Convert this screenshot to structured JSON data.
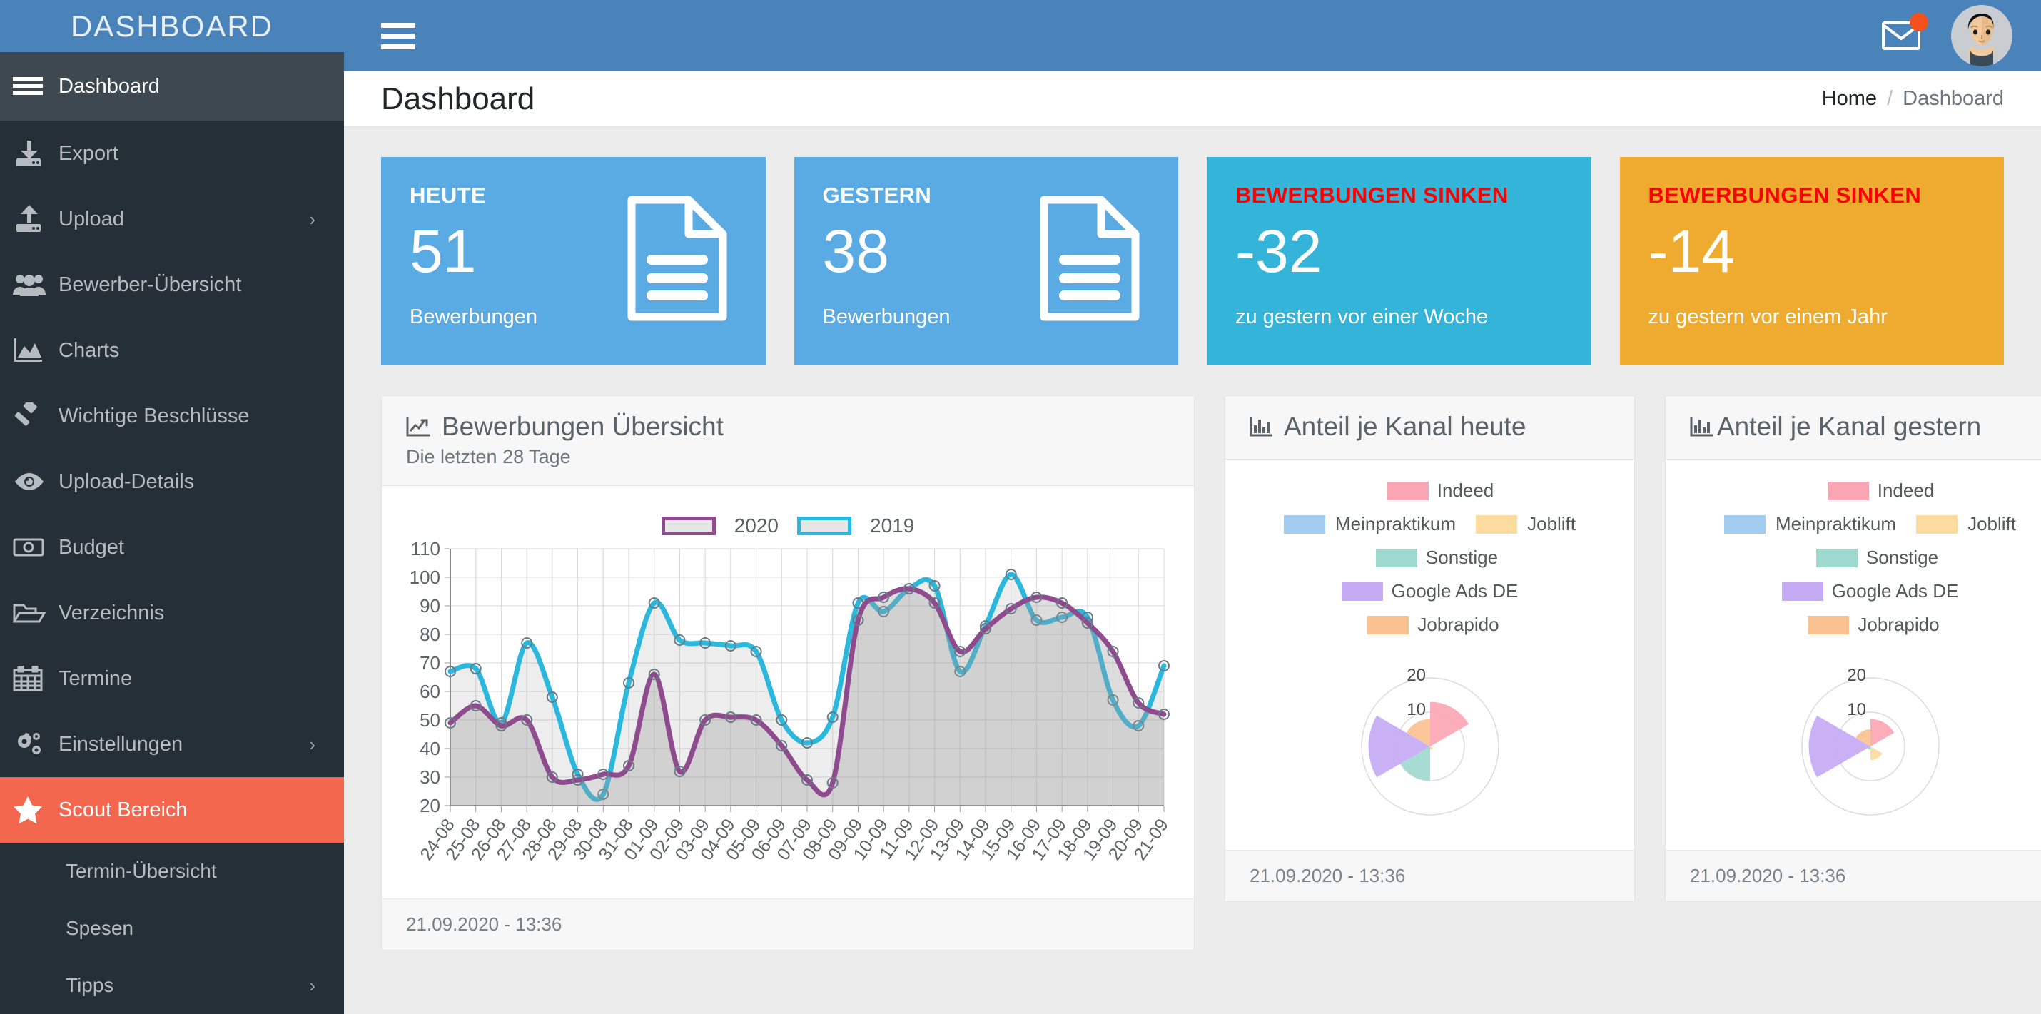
{
  "brand": {
    "title": "DASHBOARD"
  },
  "topbar": {
    "burger_icon": "hamburger-icon",
    "mail_icon": "envelope-icon",
    "avatar_icon": "user-avatar"
  },
  "pagehead": {
    "title": "Dashboard",
    "breadcrumb": {
      "home": "Home",
      "sep": "/",
      "current": "Dashboard"
    }
  },
  "sidebar": {
    "items": [
      {
        "label": "Dashboard",
        "icon": "hamburger-icon",
        "state": "active",
        "chevron": ""
      },
      {
        "label": "Export",
        "icon": "download-icon",
        "chevron": ""
      },
      {
        "label": "Upload",
        "icon": "upload-icon",
        "chevron": "›"
      },
      {
        "label": "Bewerber-Übersicht",
        "icon": "users-icon",
        "chevron": ""
      },
      {
        "label": "Charts",
        "icon": "area-chart-icon",
        "chevron": ""
      },
      {
        "label": "Wichtige Beschlüsse",
        "icon": "gavel-icon",
        "chevron": ""
      },
      {
        "label": "Upload-Details",
        "icon": "eye-icon",
        "chevron": ""
      },
      {
        "label": "Budget",
        "icon": "money-bill-icon",
        "chevron": ""
      },
      {
        "label": "Verzeichnis",
        "icon": "folder-open-icon",
        "chevron": ""
      },
      {
        "label": "Termine",
        "icon": "calendar-icon",
        "chevron": ""
      },
      {
        "label": "Einstellungen",
        "icon": "cogs-icon",
        "chevron": "›"
      },
      {
        "label": "Scout Bereich",
        "icon": "star-icon",
        "state": "active-accent",
        "chevron": ""
      }
    ],
    "subitems": [
      {
        "label": "Termin-Übersicht",
        "chevron": ""
      },
      {
        "label": "Spesen",
        "chevron": ""
      },
      {
        "label": "Tipps",
        "chevron": "›"
      }
    ],
    "accent_color": "#f4674f",
    "background_color": "#252f38"
  },
  "stats": [
    {
      "title": "HEUTE",
      "value": "51",
      "sub": "Bewerbungen",
      "theme": "blue",
      "color": "#5aaae4",
      "icon": "document-icon"
    },
    {
      "title": "GESTERN",
      "value": "38",
      "sub": "Bewerbungen",
      "theme": "blue",
      "color": "#5aaae4",
      "icon": "document-icon"
    },
    {
      "title": "BEWERBUNGEN SINKEN",
      "value": "-32",
      "sub": "zu gestern vor einer Woche",
      "theme": "cyan",
      "color": "#35b4d9",
      "title_color": "#fe0000",
      "icon": ""
    },
    {
      "title": "BEWERBUNGEN SINKEN",
      "value": "-14",
      "sub": "zu gestern vor einem Jahr",
      "theme": "amber",
      "color": "#eeab2f",
      "title_color": "#fe0000",
      "icon": ""
    }
  ],
  "panels": {
    "line_panel": {
      "title": "Bewerbungen Übersicht",
      "subtitle": "Die letzten 28 Tage",
      "icon": "line-chart-icon",
      "footer": "21.09.2020 - 13:36"
    },
    "today_panel": {
      "title": "Anteil je Kanal heute",
      "icon": "bar-chart-icon",
      "footer": "21.09.2020 - 13:36"
    },
    "yesterday_panel": {
      "title": "Anteil je Kanal gestern",
      "icon": "bar-chart-icon",
      "footer": "21.09.2020 - 13:36"
    }
  },
  "chart_data": [
    {
      "type": "area",
      "id": "bewerbungen-uebersicht",
      "title": "Bewerbungen Übersicht",
      "subtitle": "Die letzten 28 Tage",
      "xlabel": "",
      "ylabel": "",
      "ylim": [
        20,
        110
      ],
      "yticks": [
        20,
        30,
        40,
        50,
        60,
        70,
        80,
        90,
        100,
        110
      ],
      "grid": true,
      "legend_position": "top-center",
      "categories": [
        "24-08",
        "25-08",
        "26-08",
        "27-08",
        "28-08",
        "29-08",
        "30-08",
        "31-08",
        "01-09",
        "02-09",
        "03-09",
        "04-09",
        "05-09",
        "06-09",
        "07-09",
        "08-09",
        "09-09",
        "10-09",
        "11-09",
        "12-09",
        "13-09",
        "14-09",
        "15-09",
        "16-09",
        "17-09",
        "18-09",
        "19-09",
        "20-09",
        "21-09"
      ],
      "series": [
        {
          "name": "2020",
          "color": "#8e4b8e",
          "values": [
            49,
            55,
            48,
            50,
            30,
            29,
            31,
            34,
            66,
            32,
            50,
            51,
            50,
            41,
            29,
            28,
            85,
            93,
            96,
            91,
            74,
            82,
            89,
            93,
            91,
            84,
            74,
            56,
            52
          ]
        },
        {
          "name": "2019",
          "color": "#2cb8dd",
          "values": [
            67,
            68,
            49,
            77,
            58,
            31,
            24,
            63,
            91,
            78,
            77,
            76,
            74,
            50,
            42,
            51,
            91,
            88,
            96,
            97,
            67,
            83,
            101,
            85,
            86,
            86,
            57,
            48,
            69
          ]
        }
      ]
    },
    {
      "type": "pie",
      "id": "anteil-je-kanal-heute",
      "title": "Anteil je Kanal heute",
      "variant": "polar-area",
      "rticks": [
        10,
        20
      ],
      "rlim": [
        0,
        20
      ],
      "legend_position": "top",
      "categories": [
        "Indeed",
        "Meinpraktikum",
        "Joblift",
        "Sonstige",
        "Google Ads DE",
        "Jobrapido"
      ],
      "colors": [
        "#fba6b4",
        "#a3cdf0",
        "#fbdc9e",
        "#9ed9d0",
        "#c5aaf5",
        "#fbc291"
      ],
      "values": [
        13,
        0,
        1,
        10,
        18,
        8
      ]
    },
    {
      "type": "pie",
      "id": "anteil-je-kanal-gestern",
      "title": "Anteil je Kanal gestern",
      "variant": "polar-area",
      "rticks": [
        10,
        20
      ],
      "rlim": [
        0,
        20
      ],
      "legend_position": "top",
      "categories": [
        "Indeed",
        "Meinpraktikum",
        "Joblift",
        "Sonstige",
        "Google Ads DE",
        "Jobrapido"
      ],
      "colors": [
        "#fba6b4",
        "#a3cdf0",
        "#fbdc9e",
        "#9ed9d0",
        "#c5aaf5",
        "#fbc291"
      ],
      "values": [
        8,
        0,
        4,
        1,
        18,
        5
      ]
    }
  ]
}
